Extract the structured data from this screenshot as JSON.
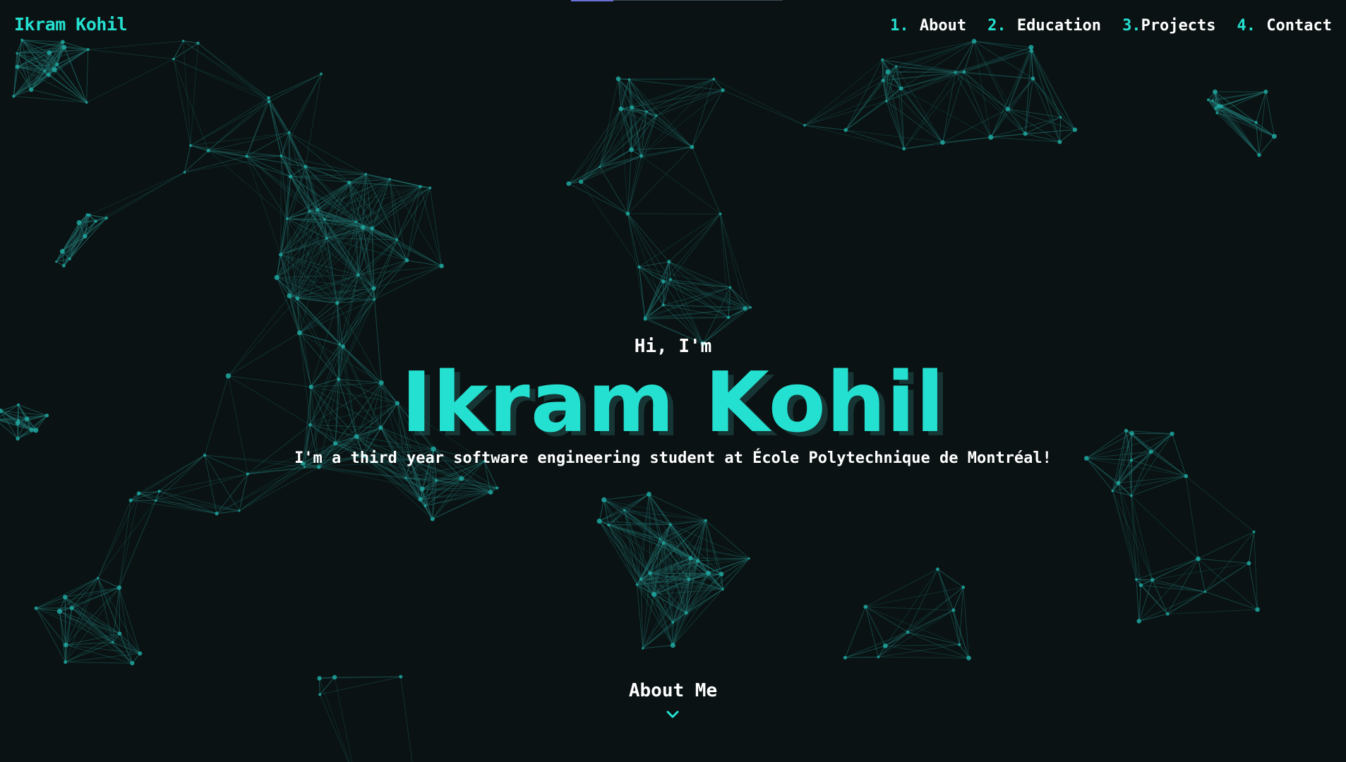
{
  "header": {
    "brand": "Ikram Kohil"
  },
  "nav": {
    "items": [
      {
        "num": "1.",
        "label": "About"
      },
      {
        "num": "2.",
        "label": "Education"
      },
      {
        "num": "3.",
        "label": "Projects"
      },
      {
        "num": "4.",
        "label": "Contact"
      }
    ]
  },
  "hero": {
    "greeting": "Hi, I'm",
    "name": "Ikram Kohil",
    "tagline": "I'm a third year software engineering student at École Polytechnique de Montréal!"
  },
  "scroll_link": {
    "label": "About Me",
    "icon": "chevron-down-icon"
  },
  "colors": {
    "background": "#0a1213",
    "accent": "#24e0d0",
    "text": "#ffffff",
    "network_line": "#1f6d6a",
    "network_node": "#1ea7a0"
  }
}
